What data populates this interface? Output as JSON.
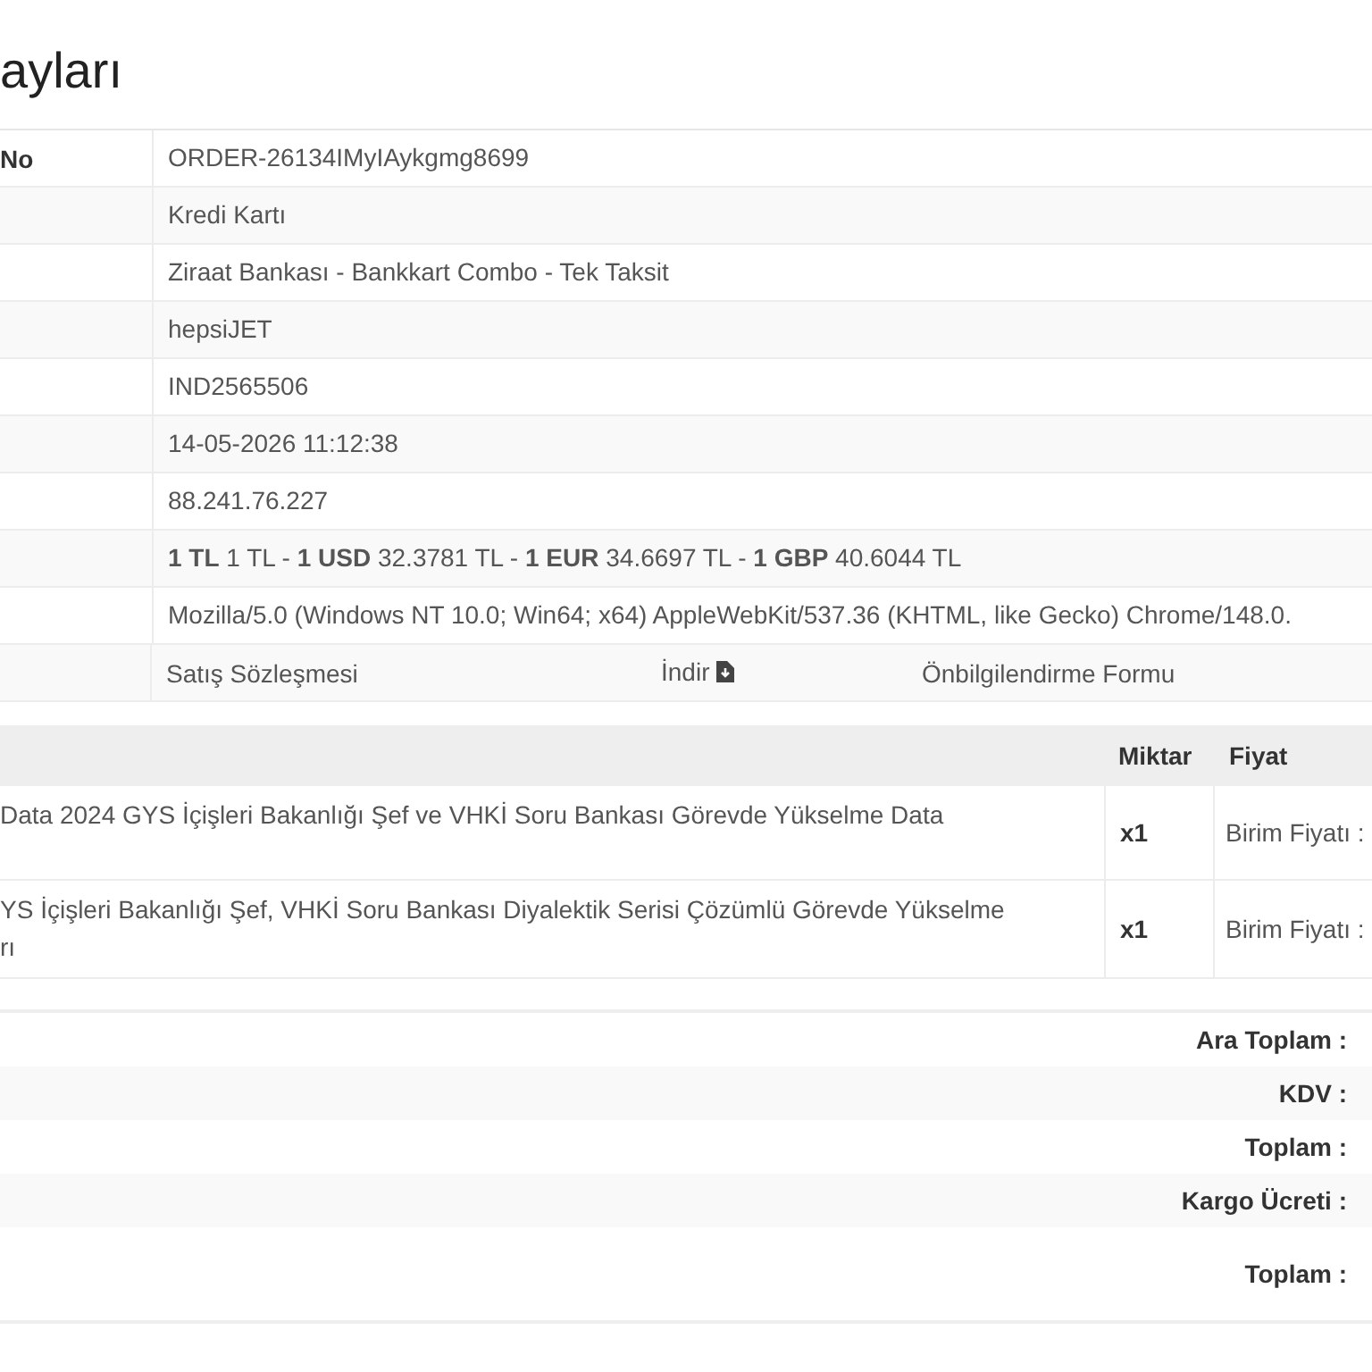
{
  "title": "ayları",
  "info_rows": [
    {
      "label": "No",
      "value": "ORDER-26134IMyIAykgmg8699"
    },
    {
      "value": "Kredi Kartı"
    },
    {
      "value": "Ziraat Bankası - Bankkart Combo - Tek Taksit"
    },
    {
      "value": "hepsiJET"
    },
    {
      "value": "IND2565506"
    },
    {
      "value": "14-05-2026 11:12:38"
    },
    {
      "value": "88.241.76.227"
    },
    {
      "value": "**1 TL** 1 TL - **1 USD** 32.3781 TL - **1 EUR** 34.6697 TL - **1 GBP** 40.6044 TL"
    },
    {
      "value": "Mozilla/5.0 (Windows NT 10.0; Win64; x64) AppleWebKit/537.36 (KHTML, like Gecko) Chrome/148.0."
    }
  ],
  "documents": {
    "contract": "Satış Sözleşmesi",
    "download": "İndir",
    "form": "Önbilgilendirme Formu"
  },
  "products": {
    "columns": [
      "Miktar",
      "Fiyat"
    ],
    "rows": [
      {
        "name_lines": [
          "Data 2024 GYS İçişleri Bakanlığı Şef ve VHKİ Soru Bankası Görevde Yükselme Data"
        ],
        "quantity": "x1",
        "price": "Birim Fiyatı :"
      },
      {
        "name_lines": [
          "YS İçişleri Bakanlığı Şef, VHKİ Soru Bankası Diyalektik Serisi Çözümlü Görevde Yükselme",
          "rı"
        ],
        "quantity": "x1",
        "price": "Birim Fiyatı :"
      }
    ]
  },
  "totals": [
    {
      "label": "Ara Toplam :"
    },
    {
      "label": "KDV :"
    },
    {
      "label": "Toplam :"
    },
    {
      "label": "Kargo Ücreti :"
    },
    {
      "label": "Toplam :",
      "kind": "grand"
    }
  ]
}
